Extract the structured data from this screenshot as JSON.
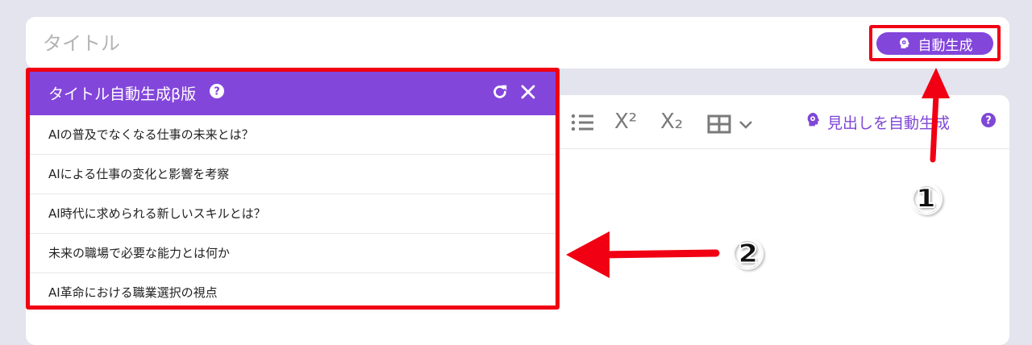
{
  "title_field": {
    "placeholder": "タイトル",
    "value": ""
  },
  "auto_generate_button": {
    "label": "自動生成",
    "icon": "head-lightbulb-icon",
    "color": "#8346db"
  },
  "toolbar": {
    "icons": [
      "bullet-list-icon",
      "superscript-icon",
      "subscript-icon",
      "table-icon",
      "chevron-down-icon"
    ],
    "superscript_glyph": "X²",
    "subscript_glyph": "X₂",
    "heading_generate_label": "見出しを自動生成"
  },
  "popup": {
    "title": "タイトル自動生成β版",
    "header_color": "#8346db",
    "items": [
      "AIの普及でなくなる仕事の未来とは？",
      "AIによる仕事の変化と影響を考察",
      "AI時代に求められる新しいスキルとは？",
      "未来の職場で必要な能力とは何か",
      "AI革命における職業選択の視点"
    ]
  },
  "annotations": {
    "marker_1": "①",
    "marker_2": "②",
    "highlight_color": "#f00012"
  }
}
